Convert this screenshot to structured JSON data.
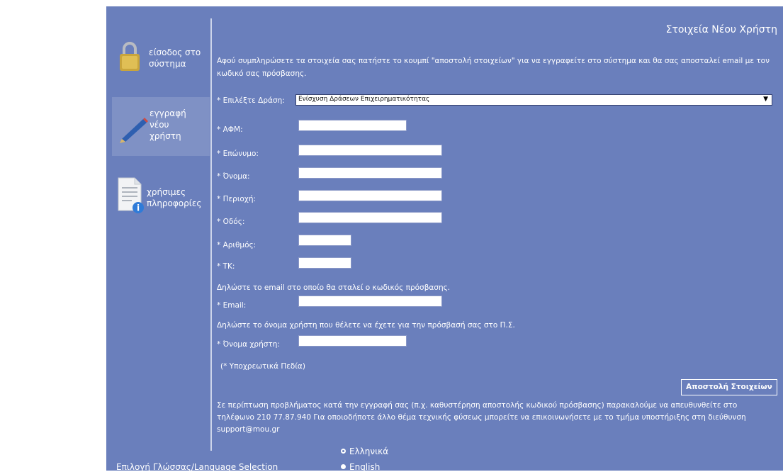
{
  "sidebar": {
    "items": [
      {
        "label_1": "είσοδος στο",
        "label_2": "σύστημα",
        "icon": "lock-icon"
      },
      {
        "label_1": "εγγραφή",
        "label_2": "νέου",
        "label_3": "χρήστη",
        "icon": "pen-icon"
      },
      {
        "label_1": "χρήσιμες",
        "label_2": "πληροφορίες",
        "icon": "info-document-icon"
      }
    ]
  },
  "header": {
    "title": "Στοιχεία Νέου Χρήστη"
  },
  "intro": "Αφού συμπληρώσετε τα στοιχεία σας πατήστε το κουμπί \"αποστολή στοιχείων\" για να εγγραφείτε στο σύστημα και θα σας αποσταλεί email με τον κωδικό σας πρόσβασης.",
  "form": {
    "action_label": "* Επιλέξτε Δράση:",
    "action_value": "Ενίσχυση Δράσεων Επιχειρηματικότητας",
    "fields": [
      {
        "label": "* ΑΦΜ:",
        "value": ""
      },
      {
        "label": "* Επώνυμο:",
        "value": ""
      },
      {
        "label": "* Όνομα:",
        "value": ""
      },
      {
        "label": "* Περιοχή:",
        "value": ""
      },
      {
        "label": "* Οδός:",
        "value": ""
      },
      {
        "label": "* Αριθμός:",
        "value": ""
      },
      {
        "label": "* ΤΚ:",
        "value": ""
      }
    ],
    "email_hint": "Δηλώστε το email στο οποίο θα σταλεί ο κωδικός πρόσβασης.",
    "email_label": "* Email:",
    "username_hint": "Δηλώστε το όνομα χρήστη που θέλετε να έχετε για την πρόσβασή σας στο Π.Σ.",
    "username_label": "* Όνομα χρήστη:",
    "required_note": "(*  Υποχρεωτικά Πεδία)",
    "submit_label": "Αποστολή Στοιχείων"
  },
  "footer": {
    "support_text": "Σε περίπτωση προβλήματος κατά την εγγραφή σας (π.χ. καθυστέρηση αποστολής κωδικού πρόσβασης) παρακαλούμε να απευθυνθείτε στο τηλέφωνο 210 77.87.940 Για οποιοδήποτε άλλο θέμα τεχνικής φύσεως μπορείτε να επικοινωνήσετε με το τμήμα υποστήριξης στη διεύθυνση support@mou.gr"
  },
  "language": {
    "label": "Επιλογή Γλώσσας/Language Selection",
    "options": [
      "Ελληνικά",
      "English"
    ],
    "selected": "Ελληνικά"
  },
  "colors": {
    "panel": "#6a7fbc",
    "active_nav": "#7f91c5"
  }
}
